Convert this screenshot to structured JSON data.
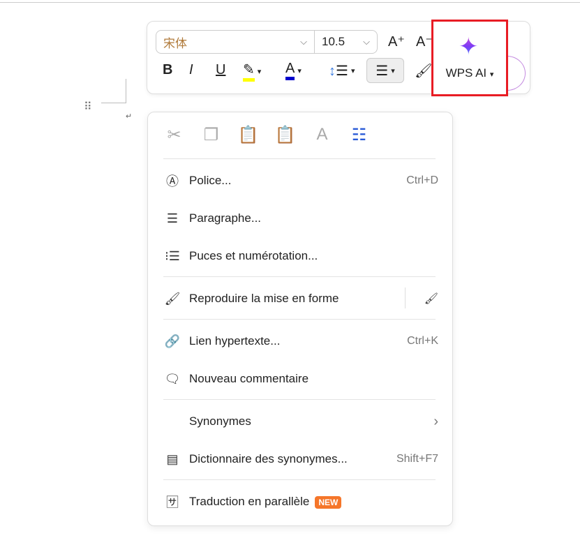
{
  "toolbar": {
    "font": "宋体",
    "size": "10.5",
    "grow": "A⁺",
    "shrink": "A⁻",
    "bold": "B",
    "italic": "I",
    "underline": "U",
    "highlight_color": "#ffff00",
    "font_color": "#0000cc",
    "wps_ai": "WPS AI"
  },
  "clipboard_icons": [
    "cut-icon",
    "copy-icon",
    "paste-keep-format-icon",
    "paste-merge-format-icon",
    "paste-text-only-icon",
    "paste-list-icon"
  ],
  "menu": [
    {
      "label": "Police...",
      "shortcut": "Ctrl+D"
    },
    {
      "label": "Paragraphe...",
      "shortcut": ""
    },
    {
      "label": "Puces et numérotation...",
      "shortcut": ""
    },
    {
      "label": "Reproduire la mise en forme",
      "shortcut": ""
    },
    {
      "label": "Lien hypertexte...",
      "shortcut": "Ctrl+K"
    },
    {
      "label": "Nouveau commentaire",
      "shortcut": ""
    },
    {
      "label": "Synonymes",
      "shortcut": ""
    },
    {
      "label": "Dictionnaire des synonymes...",
      "shortcut": "Shift+F7"
    },
    {
      "label": "Traduction en parallèle",
      "shortcut": "",
      "badge": "NEW"
    }
  ]
}
